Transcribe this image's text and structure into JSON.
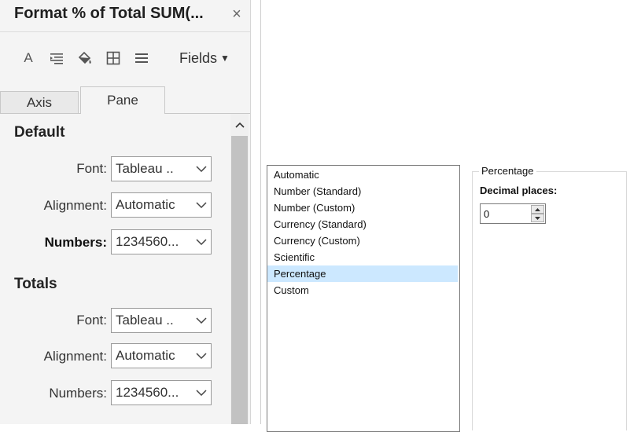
{
  "pane": {
    "title": "Format % of Total SUM(...",
    "close_glyph": "×",
    "toolbar": {
      "icons": [
        "font-icon",
        "alignment-icon",
        "shading-icon",
        "borders-icon",
        "lines-icon"
      ],
      "font_glyph": "A",
      "fields_label": "Fields"
    },
    "tabs": [
      {
        "label": "Axis",
        "active": false
      },
      {
        "label": "Pane",
        "active": true
      }
    ],
    "sections": {
      "default": {
        "heading": "Default",
        "font_label": "Font:",
        "font_value": "Tableau ..",
        "alignment_label": "Alignment:",
        "alignment_value": "Automatic",
        "numbers_label": "Numbers:",
        "numbers_value": "1234560..."
      },
      "totals": {
        "heading": "Totals",
        "font_label": "Font:",
        "font_value": "Tableau ..",
        "alignment_label": "Alignment:",
        "alignment_value": "Automatic",
        "numbers_label": "Numbers:",
        "numbers_value": "1234560..."
      }
    }
  },
  "number_format": {
    "options": [
      "Automatic",
      "Number (Standard)",
      "Number (Custom)",
      "Currency (Standard)",
      "Currency (Custom)",
      "Scientific",
      "Percentage",
      "Custom"
    ],
    "selected": "Percentage",
    "group_title": "Percentage",
    "decimal_label": "Decimal places:",
    "decimal_value": "0"
  },
  "colors": {
    "selection": "#cce8ff",
    "pane_background": "#f4f4f4"
  }
}
